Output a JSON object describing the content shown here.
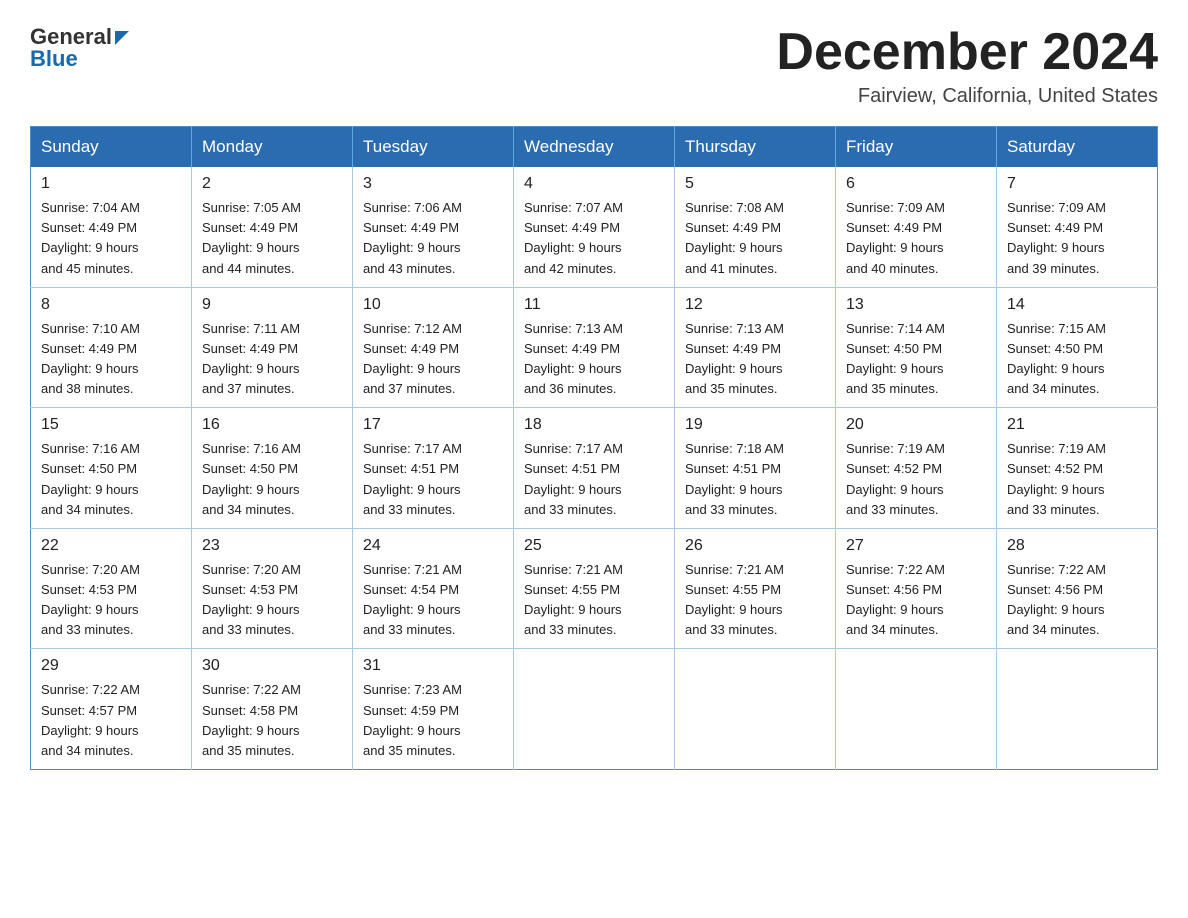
{
  "logo": {
    "text_general": "General",
    "text_blue": "Blue"
  },
  "header": {
    "month_year": "December 2024",
    "location": "Fairview, California, United States"
  },
  "weekdays": [
    "Sunday",
    "Monday",
    "Tuesday",
    "Wednesday",
    "Thursday",
    "Friday",
    "Saturday"
  ],
  "weeks": [
    [
      {
        "day": "1",
        "sunrise": "7:04 AM",
        "sunset": "4:49 PM",
        "daylight": "9 hours and 45 minutes."
      },
      {
        "day": "2",
        "sunrise": "7:05 AM",
        "sunset": "4:49 PM",
        "daylight": "9 hours and 44 minutes."
      },
      {
        "day": "3",
        "sunrise": "7:06 AM",
        "sunset": "4:49 PM",
        "daylight": "9 hours and 43 minutes."
      },
      {
        "day": "4",
        "sunrise": "7:07 AM",
        "sunset": "4:49 PM",
        "daylight": "9 hours and 42 minutes."
      },
      {
        "day": "5",
        "sunrise": "7:08 AM",
        "sunset": "4:49 PM",
        "daylight": "9 hours and 41 minutes."
      },
      {
        "day": "6",
        "sunrise": "7:09 AM",
        "sunset": "4:49 PM",
        "daylight": "9 hours and 40 minutes."
      },
      {
        "day": "7",
        "sunrise": "7:09 AM",
        "sunset": "4:49 PM",
        "daylight": "9 hours and 39 minutes."
      }
    ],
    [
      {
        "day": "8",
        "sunrise": "7:10 AM",
        "sunset": "4:49 PM",
        "daylight": "9 hours and 38 minutes."
      },
      {
        "day": "9",
        "sunrise": "7:11 AM",
        "sunset": "4:49 PM",
        "daylight": "9 hours and 37 minutes."
      },
      {
        "day": "10",
        "sunrise": "7:12 AM",
        "sunset": "4:49 PM",
        "daylight": "9 hours and 37 minutes."
      },
      {
        "day": "11",
        "sunrise": "7:13 AM",
        "sunset": "4:49 PM",
        "daylight": "9 hours and 36 minutes."
      },
      {
        "day": "12",
        "sunrise": "7:13 AM",
        "sunset": "4:49 PM",
        "daylight": "9 hours and 35 minutes."
      },
      {
        "day": "13",
        "sunrise": "7:14 AM",
        "sunset": "4:50 PM",
        "daylight": "9 hours and 35 minutes."
      },
      {
        "day": "14",
        "sunrise": "7:15 AM",
        "sunset": "4:50 PM",
        "daylight": "9 hours and 34 minutes."
      }
    ],
    [
      {
        "day": "15",
        "sunrise": "7:16 AM",
        "sunset": "4:50 PM",
        "daylight": "9 hours and 34 minutes."
      },
      {
        "day": "16",
        "sunrise": "7:16 AM",
        "sunset": "4:50 PM",
        "daylight": "9 hours and 34 minutes."
      },
      {
        "day": "17",
        "sunrise": "7:17 AM",
        "sunset": "4:51 PM",
        "daylight": "9 hours and 33 minutes."
      },
      {
        "day": "18",
        "sunrise": "7:17 AM",
        "sunset": "4:51 PM",
        "daylight": "9 hours and 33 minutes."
      },
      {
        "day": "19",
        "sunrise": "7:18 AM",
        "sunset": "4:51 PM",
        "daylight": "9 hours and 33 minutes."
      },
      {
        "day": "20",
        "sunrise": "7:19 AM",
        "sunset": "4:52 PM",
        "daylight": "9 hours and 33 minutes."
      },
      {
        "day": "21",
        "sunrise": "7:19 AM",
        "sunset": "4:52 PM",
        "daylight": "9 hours and 33 minutes."
      }
    ],
    [
      {
        "day": "22",
        "sunrise": "7:20 AM",
        "sunset": "4:53 PM",
        "daylight": "9 hours and 33 minutes."
      },
      {
        "day": "23",
        "sunrise": "7:20 AM",
        "sunset": "4:53 PM",
        "daylight": "9 hours and 33 minutes."
      },
      {
        "day": "24",
        "sunrise": "7:21 AM",
        "sunset": "4:54 PM",
        "daylight": "9 hours and 33 minutes."
      },
      {
        "day": "25",
        "sunrise": "7:21 AM",
        "sunset": "4:55 PM",
        "daylight": "9 hours and 33 minutes."
      },
      {
        "day": "26",
        "sunrise": "7:21 AM",
        "sunset": "4:55 PM",
        "daylight": "9 hours and 33 minutes."
      },
      {
        "day": "27",
        "sunrise": "7:22 AM",
        "sunset": "4:56 PM",
        "daylight": "9 hours and 34 minutes."
      },
      {
        "day": "28",
        "sunrise": "7:22 AM",
        "sunset": "4:56 PM",
        "daylight": "9 hours and 34 minutes."
      }
    ],
    [
      {
        "day": "29",
        "sunrise": "7:22 AM",
        "sunset": "4:57 PM",
        "daylight": "9 hours and 34 minutes."
      },
      {
        "day": "30",
        "sunrise": "7:22 AM",
        "sunset": "4:58 PM",
        "daylight": "9 hours and 35 minutes."
      },
      {
        "day": "31",
        "sunrise": "7:23 AM",
        "sunset": "4:59 PM",
        "daylight": "9 hours and 35 minutes."
      },
      null,
      null,
      null,
      null
    ]
  ],
  "labels": {
    "sunrise": "Sunrise:",
    "sunset": "Sunset:",
    "daylight": "Daylight:"
  }
}
